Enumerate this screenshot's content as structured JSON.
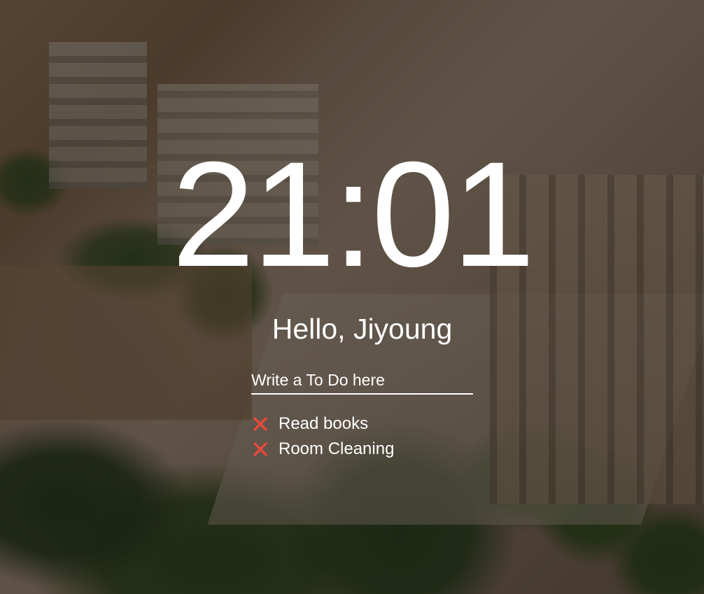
{
  "clock": {
    "time": "21:01"
  },
  "greeting": {
    "text": "Hello, Jiyoung"
  },
  "todo": {
    "placeholder": "Write a To Do here",
    "items": [
      {
        "text": "Read books",
        "delete_icon": "x-icon",
        "delete_color": "#e8493f"
      },
      {
        "text": "Room Cleaning",
        "delete_icon": "x-icon",
        "delete_color": "#e8493f"
      }
    ]
  },
  "background": {
    "description_icon": "city-photo-background"
  }
}
